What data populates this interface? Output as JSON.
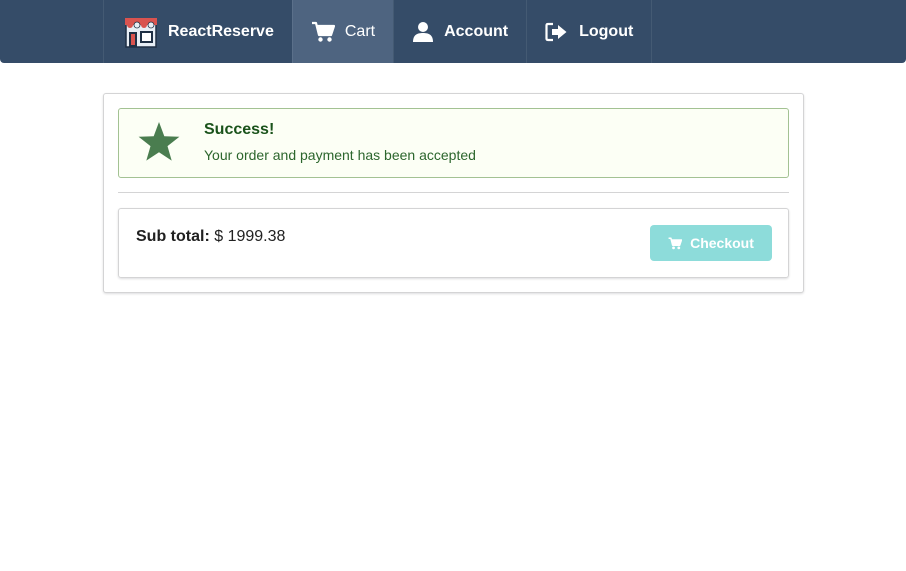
{
  "navbar": {
    "brand": "ReactReserve",
    "items": [
      {
        "label": "Cart",
        "icon": "cart-icon",
        "active": true
      },
      {
        "label": "Account",
        "icon": "user-icon",
        "active": false
      },
      {
        "label": "Logout",
        "icon": "sign-out-icon",
        "active": false
      }
    ],
    "colors": {
      "background": "#354c68",
      "active": "#4e6480"
    }
  },
  "message": {
    "icon": "star-icon",
    "header": "Success!",
    "content": "Your order and payment has been accepted",
    "colors": {
      "background": "#fcfff5",
      "border": "#a3c293",
      "text": "#2c662d"
    }
  },
  "summary": {
    "subtotal_label": "Sub total:",
    "subtotal_value": "$ 1999.38",
    "checkout_label": "Checkout",
    "checkout_icon": "cart-icon",
    "checkout_disabled": true,
    "colors": {
      "button": "#8ddcda"
    }
  }
}
